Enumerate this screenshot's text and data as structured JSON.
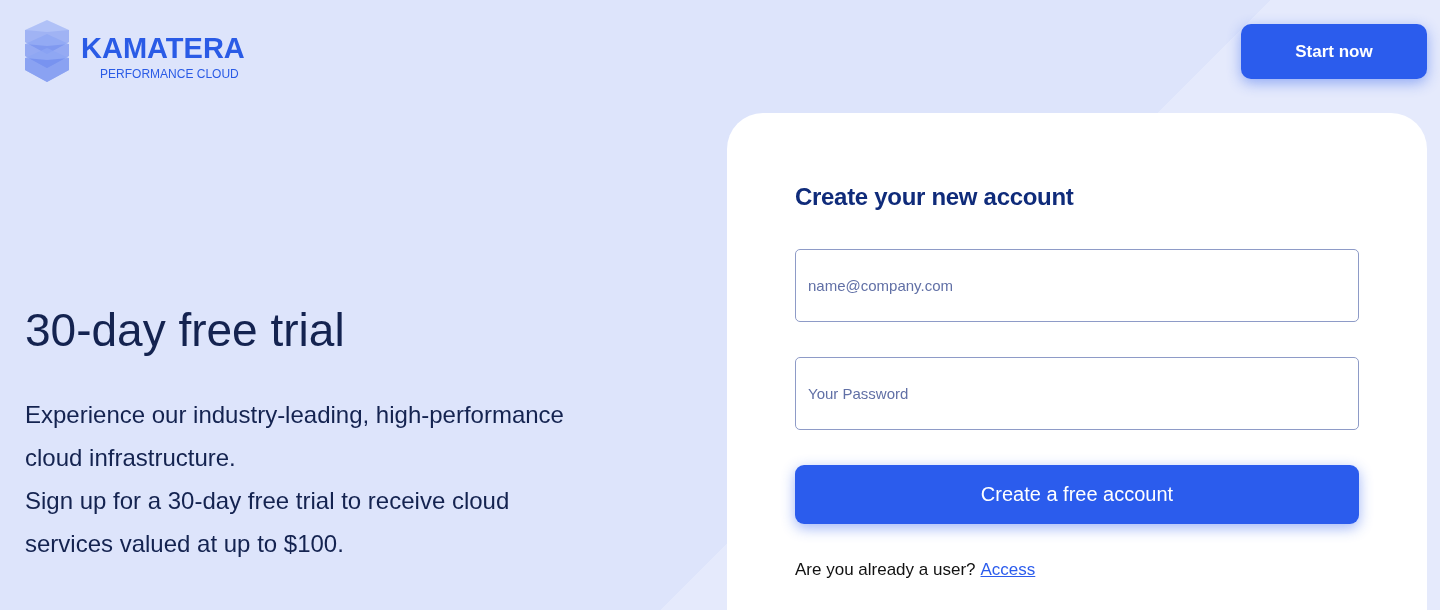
{
  "brand": {
    "name": "KAMATERA",
    "tagline": "PERFORMANCE CLOUD"
  },
  "header_button": "Start now",
  "hero": {
    "title": "30-day free trial",
    "paragraphs": [
      "Experience our industry-leading, high-performance cloud infrastructure.",
      "Sign up for a 30-day free trial to receive cloud services valued at up to $100."
    ]
  },
  "signup": {
    "title": "Create your new account",
    "fields": [
      {
        "placeholder": "name@company.com"
      },
      {
        "placeholder": "Your Password"
      }
    ],
    "submit": "Create a free account",
    "login_prompt": "Are you already a user?",
    "login_link": "Access"
  }
}
